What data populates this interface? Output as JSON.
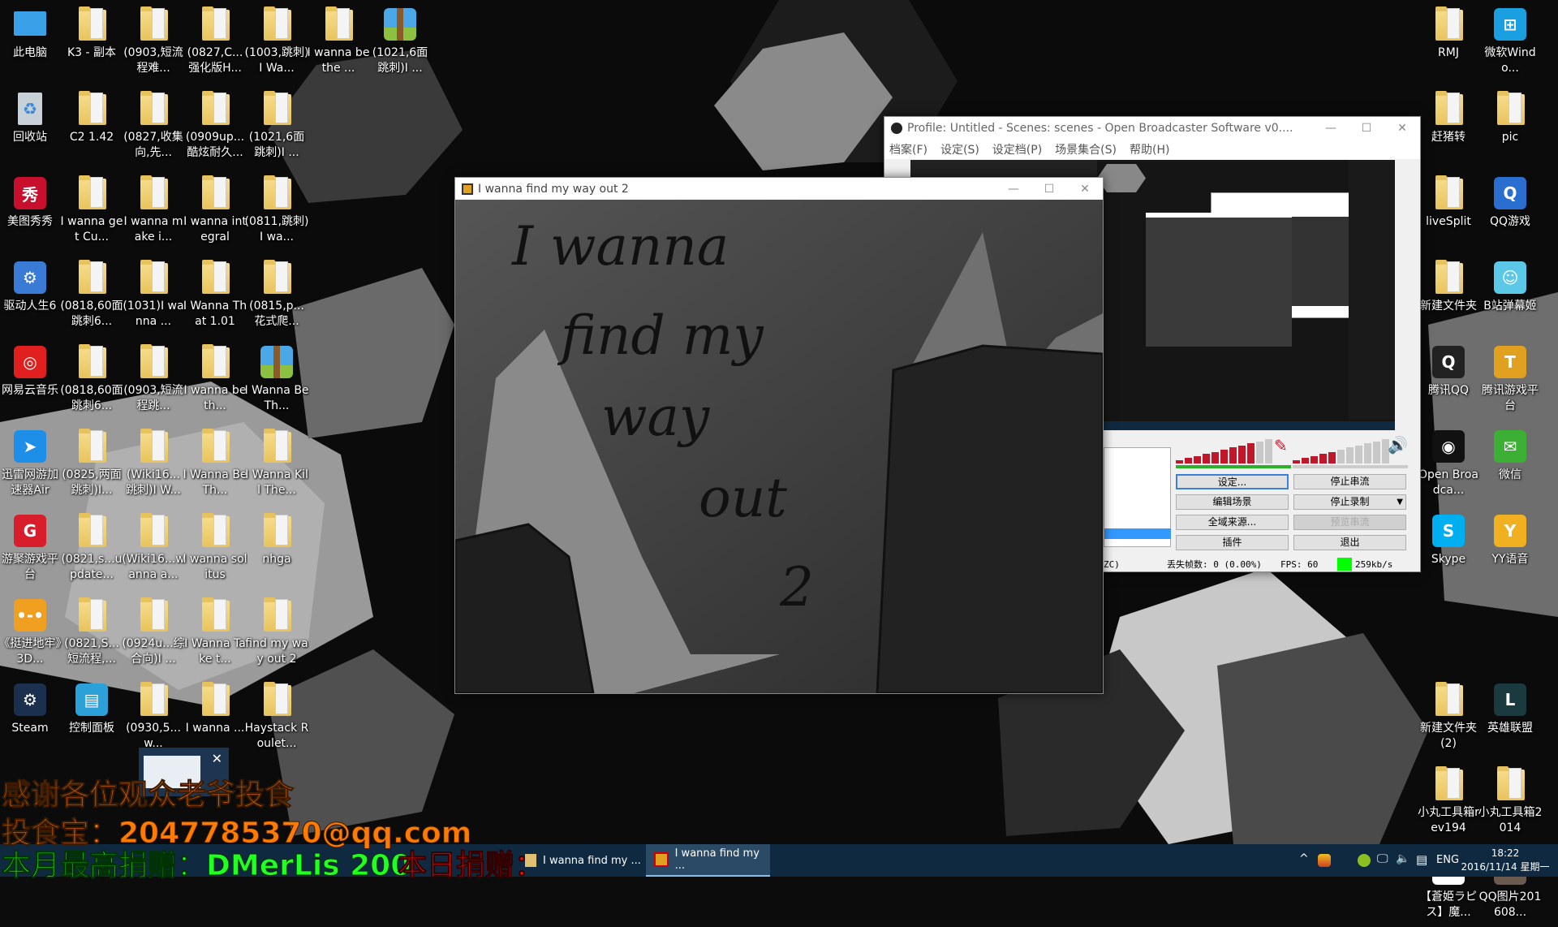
{
  "desktop": {
    "left_icons": [
      [
        {
          "label": "此电脑",
          "icon": "computer"
        },
        {
          "label": "K3 - 副本",
          "icon": "folder"
        },
        {
          "label": "(0903,短流程难...",
          "icon": "folder"
        },
        {
          "label": "(0827,C...强化版H...",
          "icon": "folder"
        },
        {
          "label": "(1003,跳刺)I Wa...",
          "icon": "folder"
        },
        {
          "label": "I wanna be the ...",
          "icon": "folder"
        },
        {
          "label": "(1021,6面跳刺)I ...",
          "icon": "archive"
        }
      ],
      [
        {
          "label": "回收站",
          "icon": "recycle-bin"
        },
        {
          "label": "C2 1.42",
          "icon": "folder"
        },
        {
          "label": "(0827,收集向,先...",
          "icon": "folder"
        },
        {
          "label": "(0909up...酷炫耐久...",
          "icon": "folder"
        },
        {
          "label": "(1021,6面跳刺)I ...",
          "icon": "folder"
        }
      ],
      [
        {
          "label": "美图秀秀",
          "icon": "app",
          "color": "#c8102e",
          "glyph": "秀"
        },
        {
          "label": "I wanna get Cu...",
          "icon": "folder"
        },
        {
          "label": "I wanna make i...",
          "icon": "folder"
        },
        {
          "label": "I wanna integral",
          "icon": "folder"
        },
        {
          "label": "(0811,跳刺)I wa...",
          "icon": "folder"
        }
      ],
      [
        {
          "label": "驱动人生6",
          "icon": "app",
          "color": "#3a7bd5",
          "glyph": "⚙"
        },
        {
          "label": "(0818,60面跳刺6...",
          "icon": "folder"
        },
        {
          "label": "(1031)I wanna ...",
          "icon": "folder"
        },
        {
          "label": "I Wanna That 1.01",
          "icon": "folder"
        },
        {
          "label": "(0815,p...花式爬...",
          "icon": "folder"
        }
      ],
      [
        {
          "label": "网易云音乐",
          "icon": "app",
          "color": "#e0201e",
          "glyph": "◎"
        },
        {
          "label": "(0818,60面跳刺6...",
          "icon": "folder"
        },
        {
          "label": "(0903,短流程跳...",
          "icon": "folder"
        },
        {
          "label": "I wanna be th...",
          "icon": "folder"
        },
        {
          "label": "I Wanna Be Th...",
          "icon": "archive"
        }
      ],
      [
        {
          "label": "迅雷网游加速器Air",
          "icon": "app",
          "color": "#1e8fe8",
          "glyph": "➤"
        },
        {
          "label": "(0825,两面跳刺)I...",
          "icon": "folder"
        },
        {
          "label": "(Wiki16...跳刺)I W...",
          "icon": "folder"
        },
        {
          "label": "I Wanna Be Th...",
          "icon": "folder"
        },
        {
          "label": "I Wanna Kill The...",
          "icon": "folder"
        }
      ],
      [
        {
          "label": "游聚游戏平台",
          "icon": "app",
          "color": "#d81e2a",
          "glyph": "G"
        },
        {
          "label": "(0821,s...update...",
          "icon": "folder"
        },
        {
          "label": "(Wiki16...wanna a...",
          "icon": "folder"
        },
        {
          "label": "I wanna solitus",
          "icon": "folder"
        },
        {
          "label": "nhga",
          "icon": "folder"
        }
      ],
      [
        {
          "label": "《挺进地牢》3D...",
          "icon": "app",
          "color": "#f0a020",
          "glyph": "•-•"
        },
        {
          "label": "(0821,S...短流程,...",
          "icon": "folder"
        },
        {
          "label": "(0924u...综合向)I ...",
          "icon": "folder"
        },
        {
          "label": "I Wanna Take t...",
          "icon": "folder"
        },
        {
          "label": "find my way out 2",
          "icon": "folder"
        }
      ],
      [
        {
          "label": "Steam",
          "icon": "app",
          "color": "#1b2f4e",
          "glyph": "⚙"
        },
        {
          "label": "控制面板",
          "icon": "app",
          "color": "#2ca0d8",
          "glyph": "▤"
        },
        {
          "label": "(0930,5...w...",
          "icon": "folder"
        },
        {
          "label": "I wanna ...",
          "icon": "folder"
        },
        {
          "label": "Haystack Roulet...",
          "icon": "folder"
        }
      ]
    ],
    "right_icons": [
      [
        {
          "label": "RMJ",
          "icon": "folder"
        },
        {
          "label": "微软Windo...",
          "icon": "app",
          "color": "#1aa0e0",
          "glyph": "⊞"
        }
      ],
      [
        {
          "label": "赶猪转",
          "icon": "folder"
        },
        {
          "label": "pic",
          "icon": "folder"
        }
      ],
      [
        {
          "label": "liveSplit",
          "icon": "folder"
        },
        {
          "label": "QQ游戏",
          "icon": "app",
          "color": "#2a6fd0",
          "glyph": "Q"
        }
      ],
      [
        {
          "label": "新建文件夹",
          "icon": "folder"
        },
        {
          "label": "B站弹幕姬",
          "icon": "app",
          "color": "#5cc8e8",
          "glyph": "☺"
        }
      ],
      [
        {
          "label": "腾讯QQ",
          "icon": "app",
          "color": "#222",
          "glyph": "Q"
        },
        {
          "label": "腾讯游戏平台",
          "icon": "app",
          "color": "#e0a020",
          "glyph": "T"
        }
      ],
      [
        {
          "label": "Open Broadca...",
          "icon": "app",
          "color": "#111",
          "glyph": "◉"
        },
        {
          "label": "微信",
          "icon": "app",
          "color": "#3cb034",
          "glyph": "✉"
        }
      ],
      [
        {
          "label": "Skype",
          "icon": "app",
          "color": "#00aff0",
          "glyph": "S"
        },
        {
          "label": "YY语音",
          "icon": "app",
          "color": "#f0b020",
          "glyph": "Y"
        }
      ],
      null,
      [
        {
          "label": "新建文件夹 (2)",
          "icon": "folder"
        },
        {
          "label": "英雄联盟",
          "icon": "app",
          "color": "#1a3a40",
          "glyph": "L"
        }
      ],
      [
        {
          "label": "小丸工具箱rev194",
          "icon": "folder"
        },
        {
          "label": "小丸工具箱2014",
          "icon": "folder"
        }
      ],
      [
        {
          "label": "【蒼姫ラピス】魔...",
          "icon": "app",
          "color": "#ffffff",
          "glyph": "◎"
        },
        {
          "label": "QQ图片201608...",
          "icon": "app",
          "color": "#6a5a50",
          "glyph": "▣"
        }
      ]
    ]
  },
  "game_window": {
    "title": "I wanna find my way out 2",
    "handwriting": [
      "I wanna",
      "find my",
      "way",
      "out",
      "2"
    ]
  },
  "obs": {
    "title": "Profile: Untitled - Scenes: scenes - Open Broadcaster Software v0....",
    "menu": [
      "档案(F)",
      "设定(S)",
      "设定档(P)",
      "场景集合(S)",
      "帮助(H)"
    ],
    "buttons": {
      "settings": "设定...",
      "stop_stream": "停止串流",
      "edit_scene": "编辑场景",
      "stop_record": "停止录制",
      "global_sources": "全域来源...",
      "preview_stream": "预览串流",
      "plugins": "插件",
      "exit": "退出"
    },
    "status": {
      "left": "ZC)",
      "dropped_frames": "丢失帧数: 0 (0.00%)",
      "fps": "FPS: 60",
      "bitrate": "259kb/s"
    },
    "mic_level": 0.75,
    "desktop_level": 0.45,
    "colors": {
      "meter": "#c0182a",
      "bitrate_ok": "#00ff00"
    }
  },
  "overlay": {
    "thanks": "感谢各位观众老爷投食",
    "donate_account": "投食宝：2047785370@qq.com",
    "top_donor": "本月最高捐赠：DMerLis 200",
    "today_donor": "本日捐赠：",
    "colors": {
      "orange": "#ff7a00",
      "green": "#22ff22",
      "red": "#ff1010"
    }
  },
  "taskbar": {
    "items": [
      {
        "label": "I wanna find my ..."
      },
      {
        "label": "I wanna find my ..."
      }
    ],
    "tray": {
      "language": "ENG",
      "time": "18:22",
      "date": "2016/11/14 星期一"
    }
  }
}
